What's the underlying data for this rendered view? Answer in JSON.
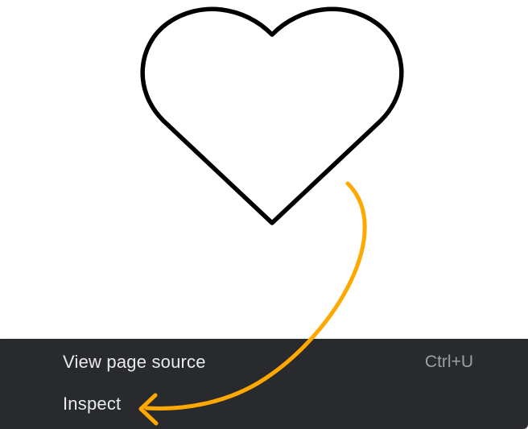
{
  "icon": {
    "name": "heart-icon",
    "stroke_color": "#000000"
  },
  "context_menu": {
    "background": "#292a2d",
    "items": [
      {
        "label": "View page source",
        "shortcut": "Ctrl+U"
      },
      {
        "label": "Inspect",
        "shortcut": ""
      }
    ]
  },
  "annotation": {
    "type": "curved-arrow",
    "color": "#ffa800",
    "points_to": "Inspect"
  }
}
